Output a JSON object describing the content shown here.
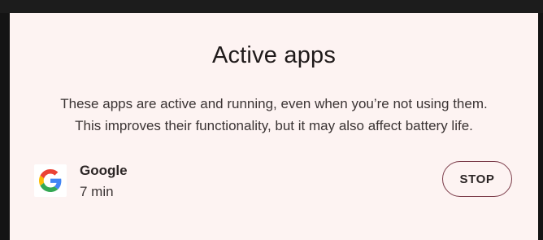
{
  "dialog": {
    "title": "Active apps",
    "description_line1": "These apps are active and running, even when you’re not using them.",
    "description_line2": "This improves their functionality, but it may also affect battery life."
  },
  "apps": [
    {
      "name": "Google",
      "time": "7 min",
      "icon": "google-g-icon",
      "action_label": "STOP"
    }
  ],
  "colors": {
    "dialog_bg": "#fdf3f2",
    "button_border": "#7a3a48",
    "text_primary": "#1f1a1a"
  }
}
